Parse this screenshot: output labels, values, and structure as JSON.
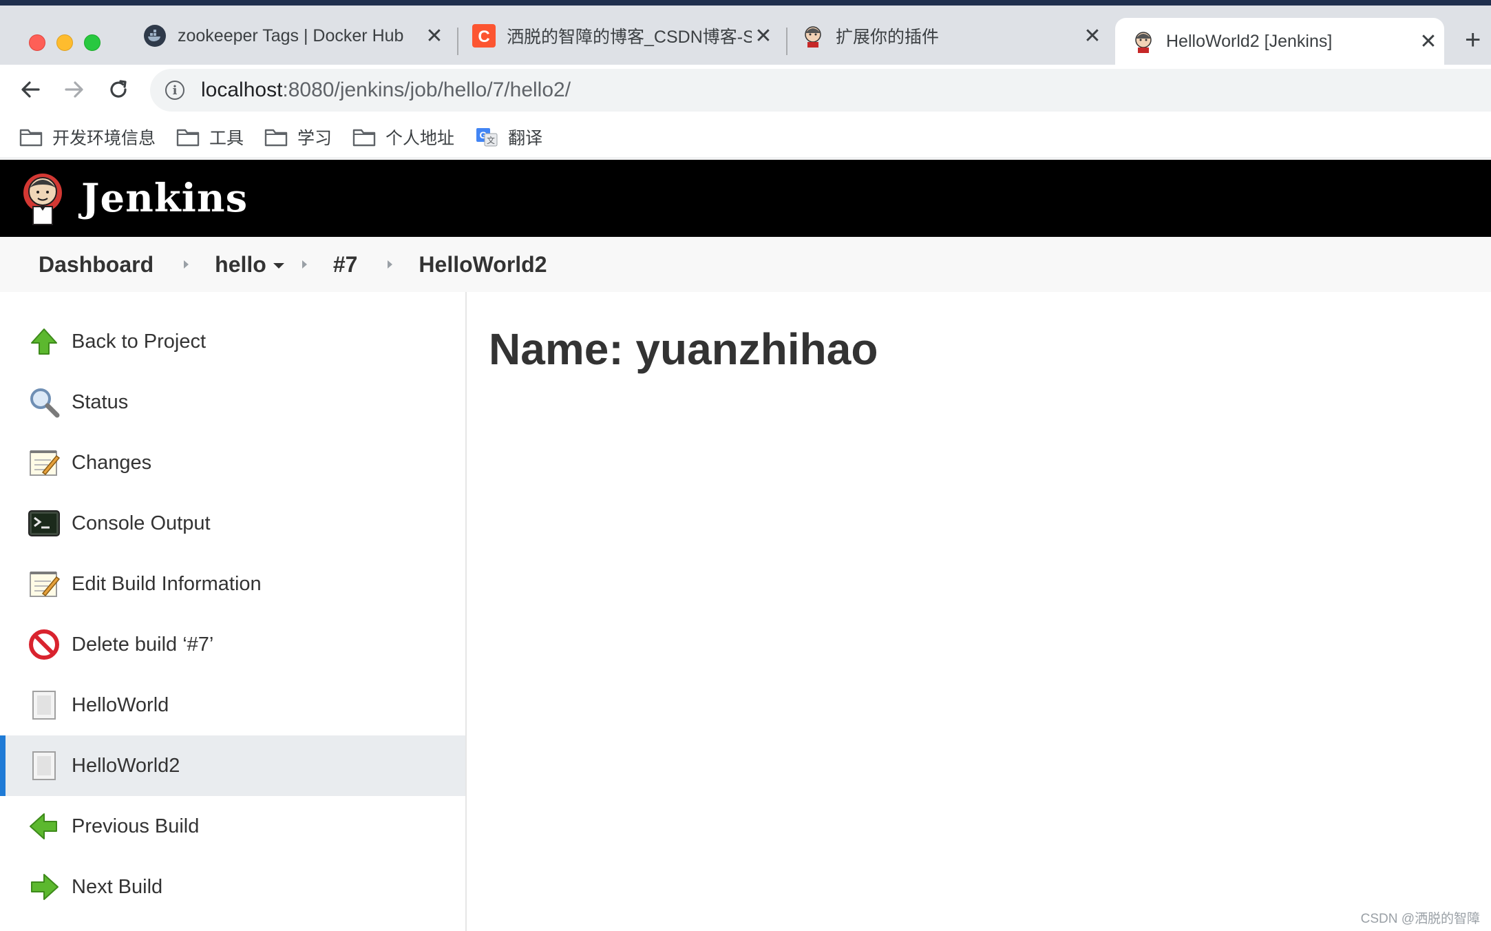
{
  "browser": {
    "tabs": [
      {
        "title": "zookeeper Tags | Docker Hub",
        "icon": "docker-whale-icon"
      },
      {
        "title": "洒脱的智障的博客_CSDN博客-S",
        "icon": "csdn-icon"
      },
      {
        "title": "扩展你的插件",
        "icon": "jenkins-butler-icon"
      },
      {
        "title": "HelloWorld2 [Jenkins]",
        "icon": "jenkins-butler-icon",
        "active": true
      }
    ],
    "address": {
      "host": "localhost",
      "path": ":8080/jenkins/job/hello/7/hello2/"
    },
    "bookmarks": [
      {
        "label": "开发环境信息",
        "icon": "folder-icon"
      },
      {
        "label": "工具",
        "icon": "folder-icon"
      },
      {
        "label": "学习",
        "icon": "folder-icon"
      },
      {
        "label": "个人地址",
        "icon": "folder-icon"
      },
      {
        "label": "翻译",
        "icon": "google-translate-icon"
      }
    ]
  },
  "jenkins": {
    "brand": "Jenkins",
    "breadcrumbs": [
      "Dashboard",
      "hello",
      "#7",
      "HelloWorld2"
    ],
    "sidebar": [
      {
        "label": "Back to Project",
        "icon": "up-arrow-icon"
      },
      {
        "label": "Status",
        "icon": "magnifier-icon"
      },
      {
        "label": "Changes",
        "icon": "notepad-icon"
      },
      {
        "label": "Console Output",
        "icon": "terminal-icon"
      },
      {
        "label": "Edit Build Information",
        "icon": "notepad-icon"
      },
      {
        "label": "Delete build ‘#7’",
        "icon": "no-entry-icon"
      },
      {
        "label": "HelloWorld",
        "icon": "document-icon"
      },
      {
        "label": "HelloWorld2",
        "icon": "document-icon",
        "active": true
      },
      {
        "label": "Previous Build",
        "icon": "left-arrow-icon"
      },
      {
        "label": "Next Build",
        "icon": "right-arrow-icon"
      }
    ],
    "main": {
      "heading": "Name: yuanzhihao"
    }
  },
  "watermark": "CSDN @洒脱的智障",
  "colors": {
    "header_bg": "#000000",
    "active_indicator": "#1f7bd6",
    "active_row_bg": "#e9ecef"
  }
}
